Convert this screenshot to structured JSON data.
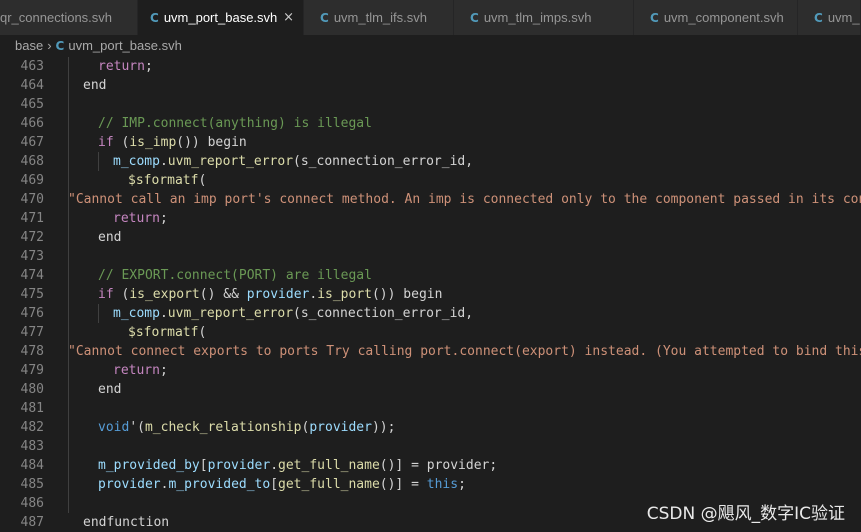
{
  "tabs": [
    {
      "label": "qr_connections.svh",
      "active": false
    },
    {
      "label": "uvm_port_base.svh",
      "active": true
    },
    {
      "label": "uvm_tlm_ifs.svh",
      "active": false
    },
    {
      "label": "uvm_tlm_imps.svh",
      "active": false
    },
    {
      "label": "uvm_component.svh",
      "active": false
    },
    {
      "label": "uvm_",
      "active": false
    }
  ],
  "tab_icon": "C",
  "close_glyph": "×",
  "breadcrumb": {
    "folder": "base",
    "separator": "›",
    "file": "uvm_port_base.svh"
  },
  "lines": [
    {
      "n": "463",
      "tokens": [
        {
          "t": "return",
          "c": "ctl"
        },
        {
          "t": ";",
          "c": "plain"
        }
      ]
    },
    {
      "n": "464",
      "tokens": [
        {
          "t": "end",
          "c": "plain"
        }
      ]
    },
    {
      "n": "465",
      "tokens": []
    },
    {
      "n": "466",
      "tokens": [
        {
          "t": "// IMP.connect(anything) is illegal",
          "c": "cm"
        }
      ]
    },
    {
      "n": "467",
      "tokens": [
        {
          "t": "if",
          "c": "ctl"
        },
        {
          "t": " (",
          "c": "plain"
        },
        {
          "t": "is_imp",
          "c": "fn"
        },
        {
          "t": "()) begin",
          "c": "plain"
        }
      ]
    },
    {
      "n": "468",
      "tokens": [
        {
          "t": "m_comp",
          "c": "var"
        },
        {
          "t": ".",
          "c": "plain"
        },
        {
          "t": "uvm_report_error",
          "c": "fn"
        },
        {
          "t": "(s_connection_error_id,",
          "c": "plain"
        }
      ]
    },
    {
      "n": "469",
      "tokens": [
        {
          "t": "$sformatf",
          "c": "fn"
        },
        {
          "t": "(",
          "c": "plain"
        }
      ]
    },
    {
      "n": "470",
      "tokens": [
        {
          "t": "\"Cannot call an imp port's connect method. An imp is connected only to the component passed in its cons",
          "c": "str"
        }
      ]
    },
    {
      "n": "471",
      "tokens": [
        {
          "t": "return",
          "c": "ctl"
        },
        {
          "t": ";",
          "c": "plain"
        }
      ]
    },
    {
      "n": "472",
      "tokens": [
        {
          "t": "end",
          "c": "plain"
        }
      ]
    },
    {
      "n": "473",
      "tokens": []
    },
    {
      "n": "474",
      "tokens": [
        {
          "t": "// EXPORT.connect(PORT) are illegal",
          "c": "cm"
        }
      ]
    },
    {
      "n": "475",
      "tokens": [
        {
          "t": "if",
          "c": "ctl"
        },
        {
          "t": " (",
          "c": "plain"
        },
        {
          "t": "is_export",
          "c": "fn"
        },
        {
          "t": "() && ",
          "c": "plain"
        },
        {
          "t": "provider",
          "c": "var"
        },
        {
          "t": ".",
          "c": "plain"
        },
        {
          "t": "is_port",
          "c": "fn"
        },
        {
          "t": "()) begin",
          "c": "plain"
        }
      ]
    },
    {
      "n": "476",
      "tokens": [
        {
          "t": "m_comp",
          "c": "var"
        },
        {
          "t": ".",
          "c": "plain"
        },
        {
          "t": "uvm_report_error",
          "c": "fn"
        },
        {
          "t": "(s_connection_error_id,",
          "c": "plain"
        }
      ]
    },
    {
      "n": "477",
      "tokens": [
        {
          "t": "$sformatf",
          "c": "fn"
        },
        {
          "t": "(",
          "c": "plain"
        }
      ]
    },
    {
      "n": "478",
      "tokens": [
        {
          "t": "\"Cannot connect exports to ports Try calling port.connect(export) instead. (You attempted to bind this",
          "c": "str"
        }
      ]
    },
    {
      "n": "479",
      "tokens": [
        {
          "t": "return",
          "c": "ctl"
        },
        {
          "t": ";",
          "c": "plain"
        }
      ]
    },
    {
      "n": "480",
      "tokens": [
        {
          "t": "end",
          "c": "plain"
        }
      ]
    },
    {
      "n": "481",
      "tokens": []
    },
    {
      "n": "482",
      "tokens": [
        {
          "t": "void",
          "c": "kw"
        },
        {
          "t": "'(",
          "c": "plain"
        },
        {
          "t": "m_check_relationship",
          "c": "fn"
        },
        {
          "t": "(",
          "c": "plain"
        },
        {
          "t": "provider",
          "c": "var"
        },
        {
          "t": "));",
          "c": "plain"
        }
      ]
    },
    {
      "n": "483",
      "tokens": []
    },
    {
      "n": "484",
      "tokens": [
        {
          "t": "m_provided_by",
          "c": "var"
        },
        {
          "t": "[",
          "c": "plain"
        },
        {
          "t": "provider",
          "c": "var"
        },
        {
          "t": ".",
          "c": "plain"
        },
        {
          "t": "get_full_name",
          "c": "fn"
        },
        {
          "t": "()] = provider;",
          "c": "plain"
        }
      ]
    },
    {
      "n": "485",
      "tokens": [
        {
          "t": "provider",
          "c": "var"
        },
        {
          "t": ".",
          "c": "plain"
        },
        {
          "t": "m_provided_to",
          "c": "var"
        },
        {
          "t": "[",
          "c": "plain"
        },
        {
          "t": "get_full_name",
          "c": "fn"
        },
        {
          "t": "()] = ",
          "c": "plain"
        },
        {
          "t": "this",
          "c": "kw"
        },
        {
          "t": ";",
          "c": "plain"
        }
      ]
    },
    {
      "n": "486",
      "tokens": []
    },
    {
      "n": "487",
      "tokens": [
        {
          "t": "endfunction",
          "c": "plain"
        }
      ]
    }
  ],
  "watermark": "CSDN @飓风_数字IC验证",
  "colors": {
    "background": "#1e1e1e",
    "keyword": "#569cd6",
    "control": "#c586c0",
    "function": "#dcdcaa",
    "variable": "#9cdcfe",
    "comment": "#6a9955",
    "string": "#ce9178",
    "line_number": "#858585",
    "file_icon": "#519aba"
  }
}
